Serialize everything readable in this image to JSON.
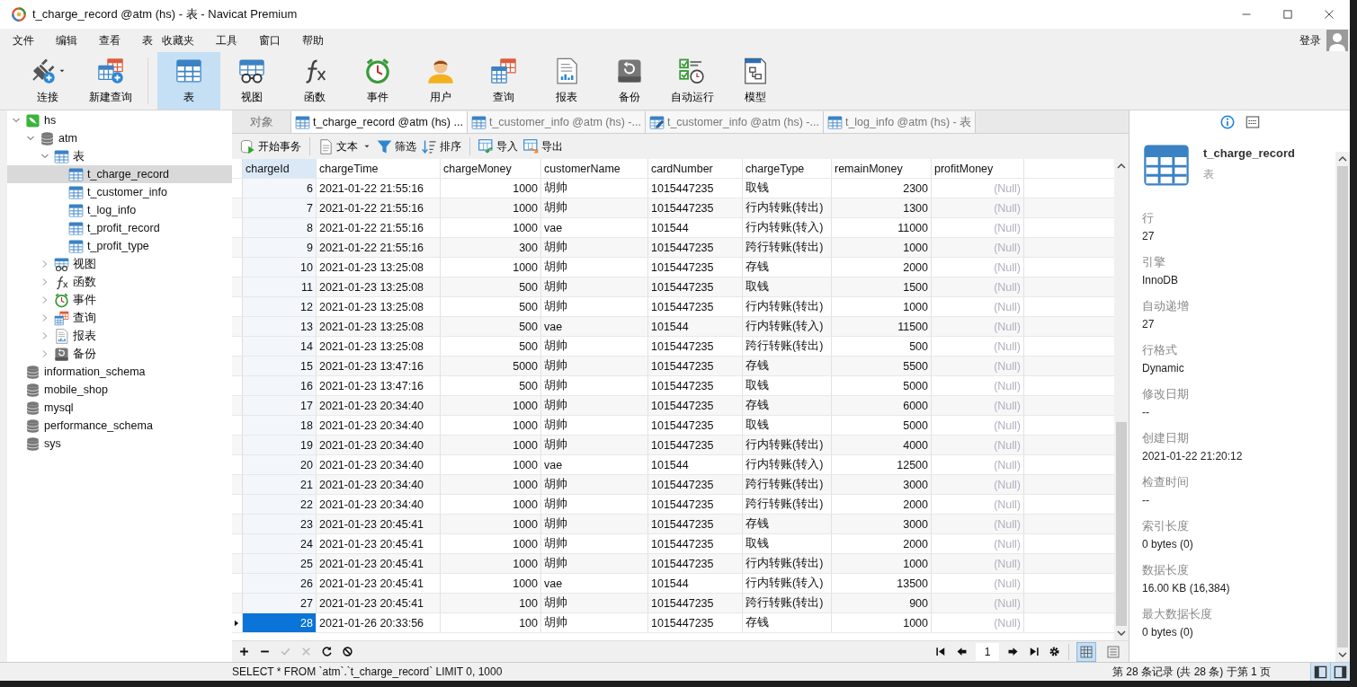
{
  "window": {
    "title": "t_charge_record @atm (hs) - 表 - Navicat Premium"
  },
  "menu": [
    "文件",
    "编辑",
    "查看",
    "表",
    "收藏夹",
    "工具",
    "窗口",
    "帮助"
  ],
  "login": "登录",
  "toolbar": [
    {
      "kind": "connect",
      "label": "连接",
      "selected": false,
      "dropdown": true
    },
    {
      "kind": "newquery",
      "label": "新建查询",
      "selected": false
    },
    {
      "kind": "table",
      "label": "表",
      "selected": true
    },
    {
      "kind": "view",
      "label": "视图",
      "selected": false
    },
    {
      "kind": "function",
      "label": "函数",
      "selected": false
    },
    {
      "kind": "event",
      "label": "事件",
      "selected": false
    },
    {
      "kind": "user",
      "label": "用户",
      "selected": false
    },
    {
      "kind": "query",
      "label": "查询",
      "selected": false
    },
    {
      "kind": "report",
      "label": "报表",
      "selected": false
    },
    {
      "kind": "backup",
      "label": "备份",
      "selected": false
    },
    {
      "kind": "autorun",
      "label": "自动运行",
      "selected": false
    },
    {
      "kind": "model",
      "label": "模型",
      "selected": false
    }
  ],
  "tree": [
    {
      "kind": "connection",
      "label": "hs",
      "expanded": true,
      "selected": false,
      "children": [
        {
          "kind": "database",
          "label": "atm",
          "expanded": true,
          "selected": false,
          "children": [
            {
              "kind": "table",
              "label": "表",
              "expanded": true,
              "selected": false,
              "children": [
                {
                  "kind": "table",
                  "label": "t_charge_record",
                  "selected": true
                },
                {
                  "kind": "table",
                  "label": "t_customer_info",
                  "selected": false
                },
                {
                  "kind": "table",
                  "label": "t_log_info",
                  "selected": false
                },
                {
                  "kind": "table",
                  "label": "t_profit_record",
                  "selected": false
                },
                {
                  "kind": "table",
                  "label": "t_profit_type",
                  "selected": false
                }
              ]
            },
            {
              "kind": "view",
              "label": "视图",
              "expanded": false,
              "selected": false
            },
            {
              "kind": "function",
              "label": "函数",
              "expanded": false,
              "selected": false
            },
            {
              "kind": "event",
              "label": "事件",
              "expanded": false,
              "selected": false
            },
            {
              "kind": "query",
              "label": "查询",
              "expanded": false,
              "selected": false
            },
            {
              "kind": "report",
              "label": "报表",
              "expanded": false,
              "selected": false
            },
            {
              "kind": "backup",
              "label": "备份",
              "expanded": false,
              "selected": false
            }
          ]
        },
        {
          "kind": "database",
          "label": "information_schema",
          "selected": false
        },
        {
          "kind": "database",
          "label": "mobile_shop",
          "selected": false
        },
        {
          "kind": "database",
          "label": "mysql",
          "selected": false
        },
        {
          "kind": "database",
          "label": "performance_schema",
          "selected": false
        },
        {
          "kind": "database",
          "label": "sys",
          "selected": false
        }
      ]
    }
  ],
  "tabs": [
    {
      "kind": "objects",
      "label": "对象",
      "selected": false
    },
    {
      "kind": "table",
      "label": "t_charge_record @atm (hs) ...",
      "selected": true
    },
    {
      "kind": "table",
      "label": "t_customer_info @atm (hs) -...",
      "selected": false
    },
    {
      "kind": "edit",
      "label": "t_customer_info @atm (hs) -...",
      "selected": false
    },
    {
      "kind": "table",
      "label": "t_log_info @atm (hs) - 表",
      "selected": false
    }
  ],
  "actions": [
    {
      "kind": "transaction",
      "label": "开始事务"
    },
    {
      "kind": "text",
      "label": "文本",
      "dropdown": true
    },
    {
      "kind": "filter",
      "label": "筛选"
    },
    {
      "kind": "sort",
      "label": "排序"
    },
    {
      "kind": "import",
      "label": "导入"
    },
    {
      "kind": "export",
      "label": "导出"
    }
  ],
  "table": {
    "columns": [
      "chargeId",
      "chargeTime",
      "chargeMoney",
      "customerName",
      "cardNumber",
      "chargeType",
      "remainMoney",
      "profitMoney"
    ],
    "rows": [
      {
        "selected": false,
        "cells": [
          "6",
          "2021-01-22 21:55:16",
          "1000",
          "胡帅",
          "1015447235",
          "取钱",
          "2300",
          "(Null)"
        ]
      },
      {
        "selected": false,
        "cells": [
          "7",
          "2021-01-22 21:55:16",
          "1000",
          "胡帅",
          "1015447235",
          "行内转账(转出)",
          "1300",
          "(Null)"
        ]
      },
      {
        "selected": false,
        "cells": [
          "8",
          "2021-01-22 21:55:16",
          "1000",
          "vae",
          "101544",
          "行内转账(转入)",
          "11000",
          "(Null)"
        ]
      },
      {
        "selected": false,
        "cells": [
          "9",
          "2021-01-22 21:55:16",
          "300",
          "胡帅",
          "1015447235",
          "跨行转账(转出)",
          "1000",
          "(Null)"
        ]
      },
      {
        "selected": false,
        "cells": [
          "10",
          "2021-01-23 13:25:08",
          "1000",
          "胡帅",
          "1015447235",
          "存钱",
          "2000",
          "(Null)"
        ]
      },
      {
        "selected": false,
        "cells": [
          "11",
          "2021-01-23 13:25:08",
          "500",
          "胡帅",
          "1015447235",
          "取钱",
          "1500",
          "(Null)"
        ]
      },
      {
        "selected": false,
        "cells": [
          "12",
          "2021-01-23 13:25:08",
          "500",
          "胡帅",
          "1015447235",
          "行内转账(转出)",
          "1000",
          "(Null)"
        ]
      },
      {
        "selected": false,
        "cells": [
          "13",
          "2021-01-23 13:25:08",
          "500",
          "vae",
          "101544",
          "行内转账(转入)",
          "11500",
          "(Null)"
        ]
      },
      {
        "selected": false,
        "cells": [
          "14",
          "2021-01-23 13:25:08",
          "500",
          "胡帅",
          "1015447235",
          "跨行转账(转出)",
          "500",
          "(Null)"
        ]
      },
      {
        "selected": false,
        "cells": [
          "15",
          "2021-01-23 13:47:16",
          "5000",
          "胡帅",
          "1015447235",
          "存钱",
          "5500",
          "(Null)"
        ]
      },
      {
        "selected": false,
        "cells": [
          "16",
          "2021-01-23 13:47:16",
          "500",
          "胡帅",
          "1015447235",
          "取钱",
          "5000",
          "(Null)"
        ]
      },
      {
        "selected": false,
        "cells": [
          "17",
          "2021-01-23 20:34:40",
          "1000",
          "胡帅",
          "1015447235",
          "存钱",
          "6000",
          "(Null)"
        ]
      },
      {
        "selected": false,
        "cells": [
          "18",
          "2021-01-23 20:34:40",
          "1000",
          "胡帅",
          "1015447235",
          "取钱",
          "5000",
          "(Null)"
        ]
      },
      {
        "selected": false,
        "cells": [
          "19",
          "2021-01-23 20:34:40",
          "1000",
          "胡帅",
          "1015447235",
          "行内转账(转出)",
          "4000",
          "(Null)"
        ]
      },
      {
        "selected": false,
        "cells": [
          "20",
          "2021-01-23 20:34:40",
          "1000",
          "vae",
          "101544",
          "行内转账(转入)",
          "12500",
          "(Null)"
        ]
      },
      {
        "selected": false,
        "cells": [
          "21",
          "2021-01-23 20:34:40",
          "1000",
          "胡帅",
          "1015447235",
          "跨行转账(转出)",
          "3000",
          "(Null)"
        ]
      },
      {
        "selected": false,
        "cells": [
          "22",
          "2021-01-23 20:34:40",
          "1000",
          "胡帅",
          "1015447235",
          "跨行转账(转出)",
          "2000",
          "(Null)"
        ]
      },
      {
        "selected": false,
        "cells": [
          "23",
          "2021-01-23 20:45:41",
          "1000",
          "胡帅",
          "1015447235",
          "存钱",
          "3000",
          "(Null)"
        ]
      },
      {
        "selected": false,
        "cells": [
          "24",
          "2021-01-23 20:45:41",
          "1000",
          "胡帅",
          "1015447235",
          "取钱",
          "2000",
          "(Null)"
        ]
      },
      {
        "selected": false,
        "cells": [
          "25",
          "2021-01-23 20:45:41",
          "1000",
          "胡帅",
          "1015447235",
          "行内转账(转出)",
          "1000",
          "(Null)"
        ]
      },
      {
        "selected": false,
        "cells": [
          "26",
          "2021-01-23 20:45:41",
          "1000",
          "vae",
          "101544",
          "行内转账(转入)",
          "13500",
          "(Null)"
        ]
      },
      {
        "selected": false,
        "cells": [
          "27",
          "2021-01-23 20:45:41",
          "100",
          "胡帅",
          "1015447235",
          "跨行转账(转出)",
          "900",
          "(Null)"
        ]
      },
      {
        "selected": true,
        "cells": [
          "28",
          "2021-01-26 20:33:56",
          "100",
          "胡帅",
          "1015447235",
          "存钱",
          "1000",
          "(Null)"
        ]
      }
    ]
  },
  "pager": {
    "page": "1"
  },
  "views": [
    {
      "kind": "grid",
      "selected": true
    },
    {
      "kind": "form",
      "selected": false
    }
  ],
  "info": {
    "name": "t_charge_record",
    "type": "表",
    "fields": [
      {
        "label": "行",
        "value": "27"
      },
      {
        "label": "引擎",
        "value": "InnoDB"
      },
      {
        "label": "自动递增",
        "value": "27"
      },
      {
        "label": "行格式",
        "value": "Dynamic"
      },
      {
        "label": "修改日期",
        "value": "--"
      },
      {
        "label": "创建日期",
        "value": "2021-01-22 21:20:12"
      },
      {
        "label": "检查时间",
        "value": "--"
      },
      {
        "label": "索引长度",
        "value": "0 bytes (0)"
      },
      {
        "label": "数据长度",
        "value": "16.00 KB (16,384)"
      },
      {
        "label": "最大数据长度",
        "value": "0 bytes (0)"
      }
    ]
  },
  "status_bar": {
    "sql": "SELECT * FROM `atm`.`t_charge_record` LIMIT 0, 1000",
    "records": "第 28 条记录 (共 28 条) 于第 1 页"
  }
}
